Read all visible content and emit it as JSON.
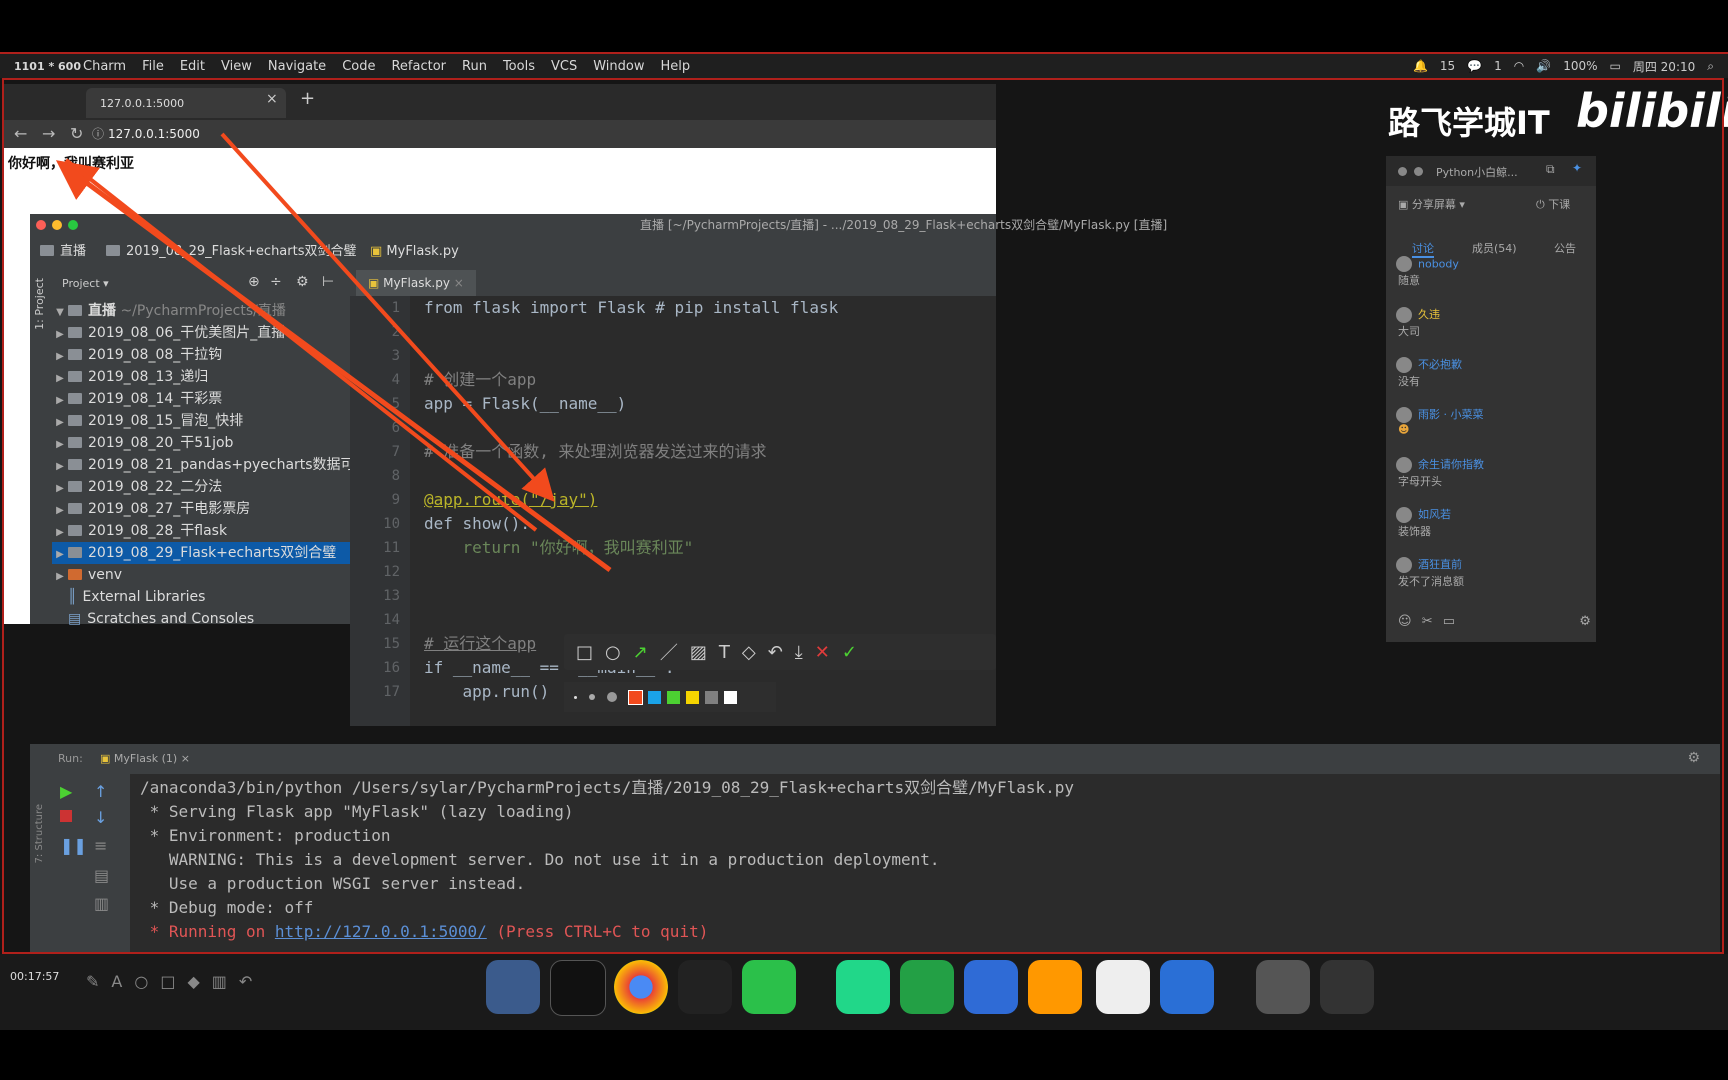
{
  "menubar": {
    "resolution": "1101 * 600",
    "app": "Charm",
    "items": [
      "File",
      "Edit",
      "View",
      "Navigate",
      "Code",
      "Refactor",
      "Run",
      "Tools",
      "VCS",
      "Window",
      "Help"
    ],
    "status": {
      "notif": "15",
      "wechat": "1",
      "battery": "100%",
      "datetime": "周四 20:10"
    }
  },
  "browser": {
    "tab_title": "127.0.0.1:5000",
    "url": "127.0.0.1:5000",
    "page_text": "你好啊，我叫赛利亚"
  },
  "pycharm": {
    "title": "直播 [~/PycharmProjects/直播] - .../2019_08_29_Flask+echarts双剑合璧/MyFlask.py [直播]",
    "crumbs": [
      "直播",
      "2019_08_29_Flask+echarts双剑合璧",
      "MyFlask.py"
    ],
    "side_label": "1: Project",
    "project_label": "Project",
    "tree": [
      {
        "label": "直播",
        "suffix": "~/PycharmProjects/直播"
      },
      {
        "label": "2019_08_06_干优美图片_直播"
      },
      {
        "label": "2019_08_08_干拉钩"
      },
      {
        "label": "2019_08_13_递归"
      },
      {
        "label": "2019_08_14_干彩票"
      },
      {
        "label": "2019_08_15_冒泡_快排"
      },
      {
        "label": "2019_08_20_干51job"
      },
      {
        "label": "2019_08_21_pandas+pyecharts数据可"
      },
      {
        "label": "2019_08_22_二分法"
      },
      {
        "label": "2019_08_27_干电影票房"
      },
      {
        "label": "2019_08_28_干flask"
      },
      {
        "label": "2019_08_29_Flask+echarts双剑合璧"
      },
      {
        "label": "venv"
      },
      {
        "label": "External Libraries"
      },
      {
        "label": "Scratches and Consoles"
      }
    ],
    "editor_tab": "MyFlask.py",
    "code": [
      "from flask import Flask # pip install flask",
      "",
      "",
      "# 创建一个app",
      "app = Flask(__name__)",
      "",
      "# 准备一个函数, 来处理浏览器发送过来的请求",
      "",
      "@app.route(\"/jay\")",
      "def show():",
      "    return \"你好啊，我叫赛利亚\"",
      "",
      "",
      "",
      "# 运行这个app",
      "if __name__ == '__main__':",
      "    app.run()"
    ],
    "line_numbers": [
      "1",
      "2",
      "3",
      "4",
      "5",
      "6",
      "7",
      "8",
      "9",
      "10",
      "11",
      "12",
      "13",
      "14",
      "15",
      "16",
      "17"
    ]
  },
  "run": {
    "tab": "MyFlask (1)",
    "run_label": "Run:",
    "structure_label": "7: Structure",
    "lines": [
      "/anaconda3/bin/python /Users/sylar/PycharmProjects/直播/2019_08_29_Flask+echarts双剑合璧/MyFlask.py",
      " * Serving Flask app \"MyFlask\" (lazy loading)",
      " * Environment: production",
      "   WARNING: This is a development server. Do not use it in a production deployment.",
      "   Use a production WSGI server instead.",
      " * Debug mode: off"
    ],
    "running_prefix": " * Running on ",
    "running_url": "http://127.0.0.1:5000/",
    "running_suffix": " (Press CTRL+C to quit)"
  },
  "chat": {
    "title": "Python小白鲸...",
    "share": "分享屏幕",
    "leave": "下课",
    "tabs": [
      "讨论",
      "成员(54)",
      "公告"
    ],
    "messages": [
      {
        "name": "nobody",
        "msg": "随意"
      },
      {
        "name": "久违",
        "msg": "大司"
      },
      {
        "name": "不必抱歉",
        "msg": "没有"
      },
      {
        "name": "雨影 · 小菜菜",
        "msg": ""
      },
      {
        "name": "余生请你指教",
        "msg": "字母开头"
      },
      {
        "name": "如风若",
        "msg": "装饰器"
      },
      {
        "name": "酒狂直前",
        "msg": "发不了消息额"
      }
    ]
  },
  "watermark": {
    "text": "路飞学城IT",
    "logo": "bilibili"
  },
  "dock": {
    "timer": "00:17:57"
  },
  "colors": {
    "annotation_red": "#f24a1d",
    "selection_blue": "#0d5aa7",
    "palette": [
      "#f24a1d",
      "#1aa3e8",
      "#4cd132",
      "#f5d400",
      "#808080",
      "#ffffff"
    ]
  }
}
